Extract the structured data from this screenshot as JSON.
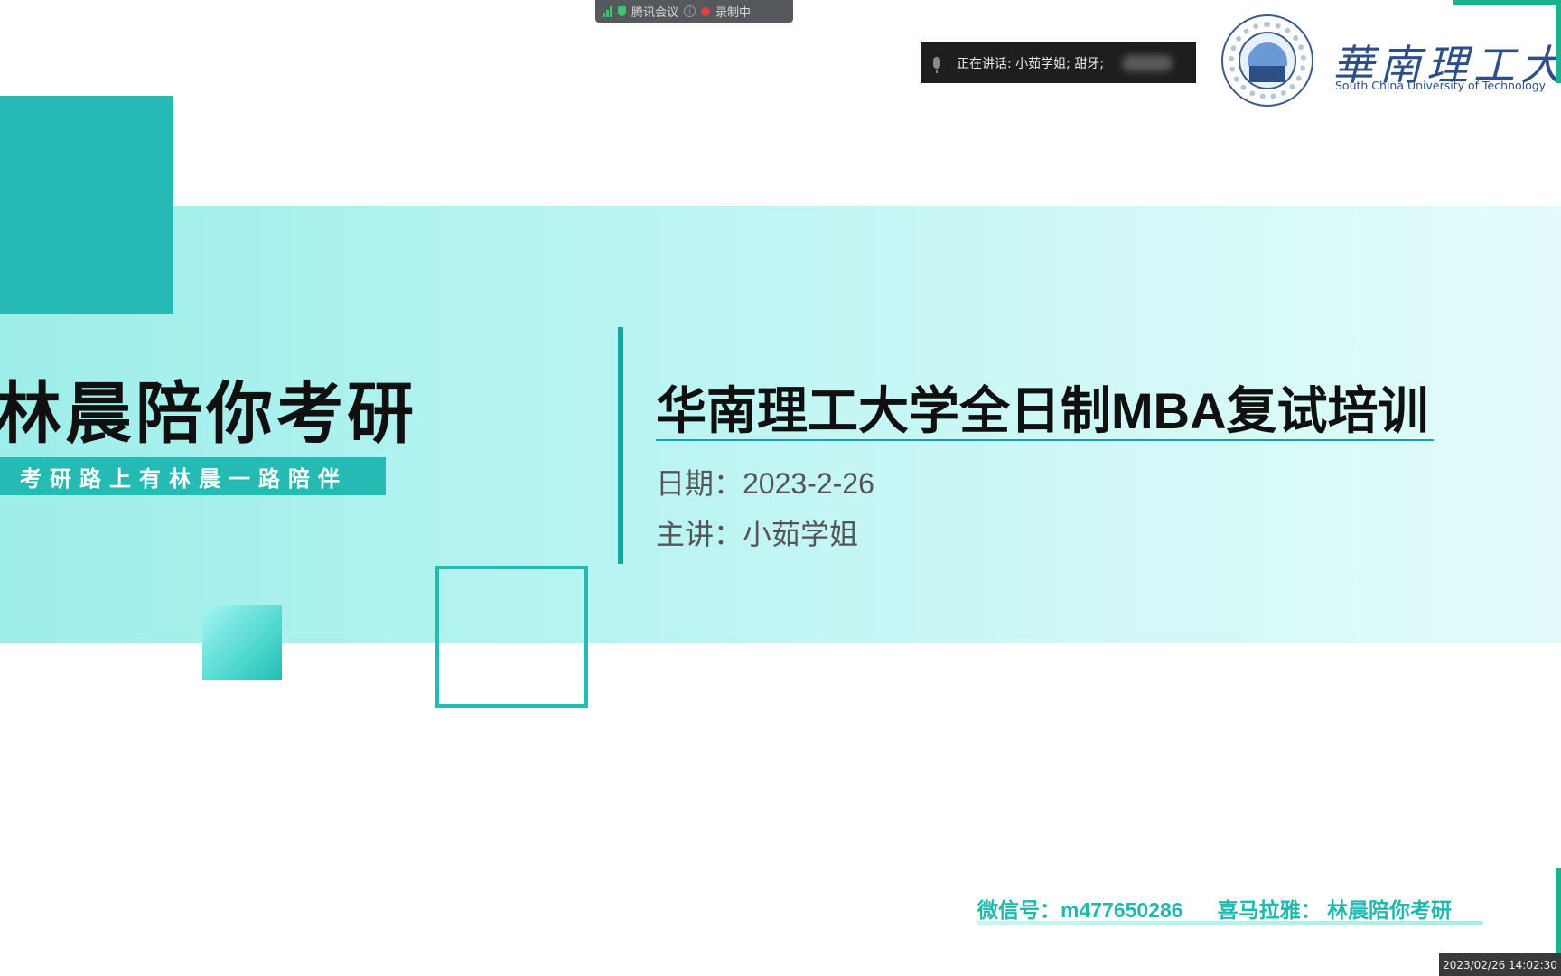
{
  "meeting_bar": {
    "app_name": "腾讯会议",
    "info_glyph": "i",
    "recording_label": "录制中",
    "icons": [
      "signal-icon",
      "shield-icon",
      "info-icon",
      "record-dot-icon"
    ],
    "accent_color": "#3fc46a"
  },
  "speaking": {
    "label": "正在讲话: 小茹学姐; 甜牙;",
    "icon": "mic-icon"
  },
  "logo": {
    "name_cn": "華南理工大學",
    "name_en": "South China University of Technology",
    "color": "#2d4f86"
  },
  "slide": {
    "brand_title": "林晨陪你考研",
    "brand_tagline": "考研路上有林晨一路陪伴",
    "title": "华南理工大学全日制MBA复试培训",
    "date_line": "日期：2023-2-26",
    "speaker_line": "主讲：小茹学姐",
    "accent_color": "#25bab4"
  },
  "footer": {
    "wechat": "微信号：m477650286",
    "ximalaya": "喜马拉雅： 林晨陪你考研"
  },
  "timestamp": "2023/02/26 14:02:30"
}
